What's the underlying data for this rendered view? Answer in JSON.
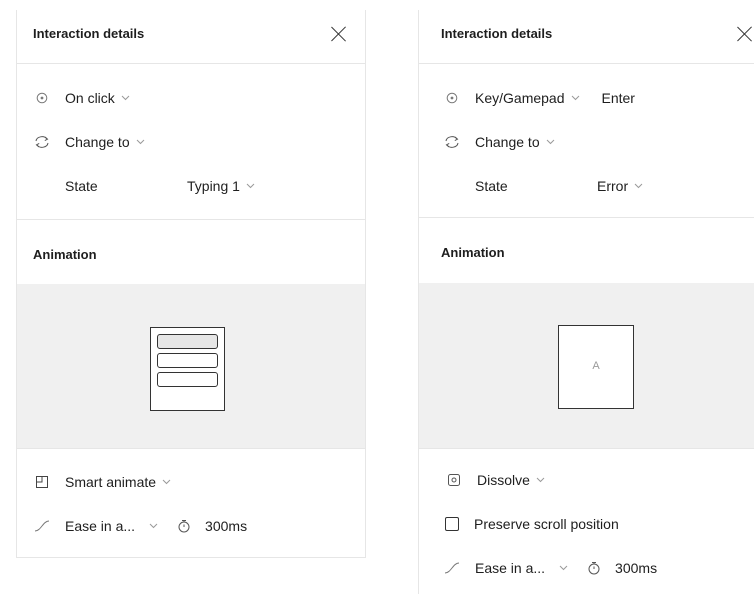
{
  "left_panel": {
    "title": "Interaction details",
    "trigger": {
      "label": "On click"
    },
    "action": {
      "label": "Change to"
    },
    "state": {
      "label": "State",
      "value": "Typing 1"
    },
    "animation_title": "Animation",
    "transition": {
      "label": "Smart animate"
    },
    "easing": {
      "label": "Ease in a...",
      "duration": "300ms"
    }
  },
  "right_panel": {
    "title": "Interaction details",
    "trigger": {
      "label": "Key/Gamepad",
      "key": "Enter"
    },
    "action": {
      "label": "Change to"
    },
    "state": {
      "label": "State",
      "value": "Error"
    },
    "animation_title": "Animation",
    "preview_letter": "A",
    "transition": {
      "label": "Dissolve"
    },
    "preserve_scroll": {
      "label": "Preserve scroll position",
      "checked": false
    },
    "easing": {
      "label": "Ease in a...",
      "duration": "300ms"
    }
  },
  "icons": {
    "trigger": "target-circle-icon",
    "action": "swap-arrows-icon",
    "smart_animate": "smart-animate-icon",
    "dissolve": "dissolve-icon",
    "easing": "ease-curve-icon",
    "duration": "stopwatch-icon",
    "chevron": "chevron-down-icon",
    "close": "close-icon"
  },
  "colors": {
    "text": "#1e1e1e",
    "muted": "#7a7a7a",
    "divider": "#e6e6e6",
    "preview_bg": "#f0f0f0"
  }
}
